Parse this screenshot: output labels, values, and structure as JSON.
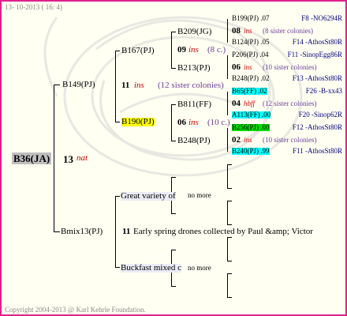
{
  "header": {
    "date": "13- 10-2013 ( 16: 4)"
  },
  "footer": {
    "copyright": "Copyright 2004-2013 @ Karl Kehrle Foundation."
  },
  "root": {
    "id": "B36(JA)",
    "year": "13",
    "origin": "nat"
  },
  "gen1": {
    "dam": {
      "id": "B149(PJ)"
    },
    "sire": {
      "id": "Bmix13(PJ)",
      "year": "11",
      "note": "Early spring drones collected by Paul &amp; Victor"
    }
  },
  "gen2": {
    "b167": {
      "id": "B167(PJ)"
    },
    "b190": {
      "id": "B190(PJ)",
      "year": "11",
      "origin": "ins",
      "sisters": "(12 sister colonies)"
    },
    "great": {
      "id": "Great variety of",
      "note": "no more"
    },
    "buck": {
      "id": "Buckfast mixed c",
      "note": "no more"
    }
  },
  "gen3": {
    "b209": {
      "id": "B209(JG)",
      "year": "09",
      "origin": "ins",
      "sisters": "(8 c.)"
    },
    "b213": {
      "id": "B213(PJ)"
    },
    "b811": {
      "id": "B811(FF)",
      "year": "06",
      "origin": "ins",
      "sisters": "(10 c.)"
    },
    "b248": {
      "id": "B248(PJ)"
    }
  },
  "gen4": [
    {
      "kind": "queen",
      "id": "B199(PJ)",
      "val": ".07",
      "drone": "F8 -NO6294R",
      "hl": ""
    },
    {
      "kind": "info",
      "year": "08",
      "origin": "ins",
      "note": "(8 sister colonies)"
    },
    {
      "kind": "queen",
      "id": "B124(PJ)",
      "val": ".05",
      "drone": "F14 -AthosSt80R",
      "hl": ""
    },
    {
      "kind": "queen",
      "id": "P206(PJ)",
      "val": ".04",
      "drone": "F11 -SinopEgg86R",
      "hl": ""
    },
    {
      "kind": "info",
      "year": "06",
      "origin": "ins",
      "note": "(10 sister colonies)"
    },
    {
      "kind": "queen",
      "id": "B248(PJ)",
      "val": ".02",
      "drone": "F13 -AthosSt80R",
      "hl": ""
    },
    {
      "kind": "queen",
      "id": "B65(FF)",
      "val": ".02",
      "drone": "F26 -B-xx43",
      "hl": "#00ffff"
    },
    {
      "kind": "info",
      "year": "04",
      "origin": "hbff",
      "note": "(12 sister colonies)"
    },
    {
      "kind": "queen",
      "id": "A113(FF)",
      "val": ".00",
      "drone": "F20 -Sinop62R",
      "hl": "#00ffff"
    },
    {
      "kind": "queen",
      "id": "B256(PJ)",
      "val": ".00",
      "drone": "F12 -AthosSt80R",
      "hl": "#00dd00"
    },
    {
      "kind": "info",
      "year": "02",
      "origin": "ins",
      "note": "(10 sister colonies)"
    },
    {
      "kind": "queen",
      "id": "B240(PJ)",
      "val": ".99",
      "drone": "F11 -AthosSt80R",
      "hl": "#00ffff"
    }
  ]
}
